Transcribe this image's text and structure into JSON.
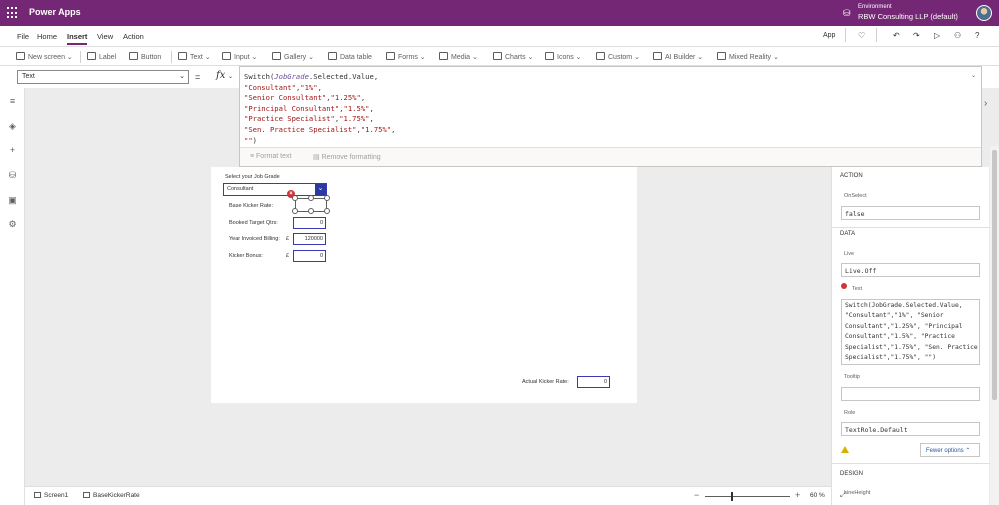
{
  "app": {
    "name": "Power Apps"
  },
  "environment": {
    "label": "Environment",
    "name": "RBW Consulting LLP (default)"
  },
  "menu": {
    "tabs": [
      "File",
      "Home",
      "Insert",
      "View",
      "Action"
    ],
    "active": "Insert",
    "app_label": "App"
  },
  "ribbon": {
    "items": [
      "New screen",
      "Label",
      "Button",
      "Text",
      "Input",
      "Gallery",
      "Data table",
      "Forms",
      "Media",
      "Charts",
      "Icons",
      "Custom",
      "AI Builder",
      "Mixed Reality"
    ]
  },
  "formula_bar": {
    "property": "Text",
    "equals": "=",
    "fx": "fx",
    "code_lines": [
      [
        "Switch(",
        "JobGrade",
        ".Selected.Value,"
      ],
      [
        "\"Consultant\"",
        ",",
        "\"1%\"",
        ","
      ],
      [
        "\"Senior Consultant\"",
        ",",
        "\"1.25%\"",
        ","
      ],
      [
        "\"Principal Consultant\"",
        ",",
        "\"1.5%\"",
        ","
      ],
      [
        "\"Practice Specialist\"",
        ",",
        "\"1.75%\"",
        ","
      ],
      [
        "\"Sen. Practice Specialist\"",
        ",",
        "\"1.75%\"",
        ","
      ],
      [
        "\"\"",
        ")"
      ]
    ],
    "format_text": "Format text",
    "remove_formatting": "Remove formatting"
  },
  "canvas": {
    "select_label": "Select your Job Grade",
    "dropdown_value": "Consultant",
    "base_kicker_label": "Base Kicker Rate:",
    "booked_target_label": "Booked Target Qtrs:",
    "booked_target_value": "0",
    "year_billing_label": "Year Invoiced Billing:",
    "currency_1": "£",
    "year_billing_value": "120000",
    "kicker_bonus_label": "Kicker Bonus:",
    "currency_2": "£",
    "kicker_bonus_value": "0",
    "actual_rate_label": "Actual Kicker Rate:",
    "actual_rate_value": "0"
  },
  "panel": {
    "action_heading": "ACTION",
    "onselect_label": "OnSelect",
    "onselect_value": "false",
    "data_heading": "DATA",
    "live_label": "Live",
    "live_value": "Live.Off",
    "text_label": "Text",
    "text_value": "Switch(JobGrade.Selected.Value,\n\"Consultant\",\"1%\", \"Senior\nConsultant\",\"1.25%\", \"Principal\nConsultant\",\"1.5%\", \"Practice\nSpecialist\",\"1.75%\", \"Sen. Practice\nSpecialist\",\"1.75%\", \"\")",
    "tooltip_label": "Tooltip",
    "tooltip_value": "",
    "role_label": "Role",
    "role_value": "TextRole.Default",
    "fewer_options": "Fewer options",
    "design_heading": "DESIGN",
    "lineheight_label": "LineHeight"
  },
  "bottom": {
    "screen_crumb": "Screen1",
    "control_crumb": "BaseKickerRate",
    "zoom_minus": "−",
    "zoom_plus": "+",
    "zoom": "60",
    "zoom_unit": "%"
  },
  "colors": {
    "brand": "#742774",
    "accent": "#3a3ab5",
    "error": "#d13438",
    "warning": "#d8b000"
  }
}
